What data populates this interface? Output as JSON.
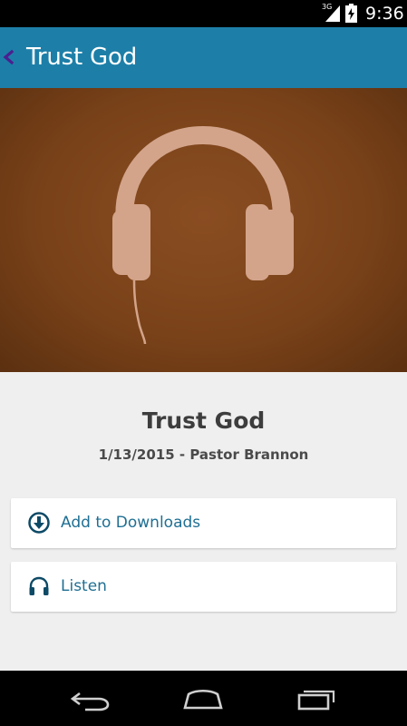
{
  "status_bar": {
    "network": "3G",
    "time": "9:36"
  },
  "header": {
    "title": "Trust God",
    "back_icon": "chevron-left-icon",
    "accent_color": "#1d7fa8"
  },
  "artwork": {
    "icon": "headphones-icon"
  },
  "sermon": {
    "title": "Trust God",
    "meta": "1/13/2015 - Pastor Brannon"
  },
  "actions": {
    "downloads": {
      "label": "Add to Downloads",
      "icon": "download-circle-icon"
    },
    "listen": {
      "label": "Listen",
      "icon": "headphones-icon"
    }
  },
  "nav_bar": {
    "back_icon": "back-arrow-icon",
    "home_icon": "home-icon",
    "recents_icon": "recent-apps-icon"
  }
}
